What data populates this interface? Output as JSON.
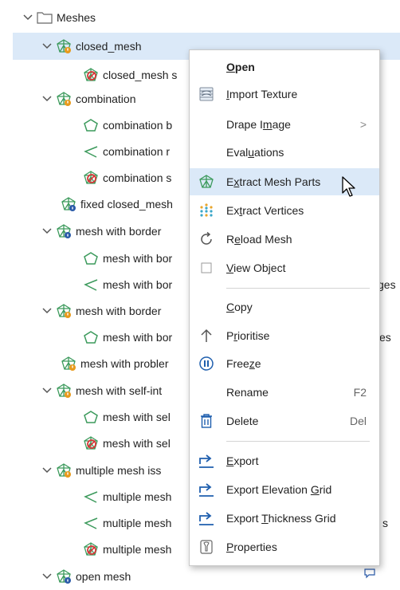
{
  "tree": {
    "rows": [
      {
        "label": "Meshes",
        "icon": "folder-icon",
        "expanded": true,
        "trail": ""
      },
      {
        "label": "closed_mesh",
        "icon": "mesh-warning-icon",
        "expanded": true,
        "trail": ""
      },
      {
        "label": "closed_mesh s",
        "icon": "mesh-error-icon",
        "expanded": null,
        "trail": ""
      },
      {
        "label": "combination",
        "icon": "mesh-warning-icon",
        "expanded": true,
        "trail": ""
      },
      {
        "label": "combination b",
        "icon": "boundary-icon",
        "expanded": null,
        "trail": ""
      },
      {
        "label": "combination r",
        "icon": "open-edges-icon",
        "expanded": null,
        "trail": ""
      },
      {
        "label": "combination s",
        "icon": "mesh-error-icon",
        "expanded": null,
        "trail": ""
      },
      {
        "label": "fixed closed_mesh",
        "icon": "mesh-info-icon",
        "expanded": null,
        "trail": ""
      },
      {
        "label": "mesh with border",
        "icon": "mesh-info-icon",
        "expanded": true,
        "trail": ""
      },
      {
        "label": "mesh with bor",
        "icon": "boundary-icon",
        "expanded": null,
        "trail": ""
      },
      {
        "label": "mesh with bor",
        "icon": "open-edges-icon",
        "expanded": null,
        "trail": "ges"
      },
      {
        "label": "mesh with border",
        "icon": "mesh-warning-icon",
        "expanded": true,
        "trail": ""
      },
      {
        "label": "mesh with bor",
        "icon": "boundary-icon",
        "expanded": null,
        "trail": "es"
      },
      {
        "label": "mesh with probler",
        "icon": "mesh-warning-icon",
        "expanded": null,
        "trail": ""
      },
      {
        "label": "mesh with self-int",
        "icon": "mesh-warning-icon",
        "expanded": true,
        "trail": ""
      },
      {
        "label": "mesh with sel",
        "icon": "boundary-icon",
        "expanded": null,
        "trail": ""
      },
      {
        "label": "mesh with sel",
        "icon": "mesh-error-icon",
        "expanded": null,
        "trail": ""
      },
      {
        "label": "multiple mesh iss",
        "icon": "mesh-warning-icon",
        "expanded": true,
        "trail": ""
      },
      {
        "label": "multiple mesh",
        "icon": "open-edges-icon",
        "expanded": null,
        "trail": ""
      },
      {
        "label": "multiple mesh",
        "icon": "open-edges-icon",
        "expanded": null,
        "trail": "s"
      },
      {
        "label": "multiple mesh",
        "icon": "mesh-error-icon",
        "expanded": null,
        "trail": ""
      },
      {
        "label": "open mesh",
        "icon": "mesh-info-icon",
        "expanded": true,
        "trail": ""
      }
    ]
  },
  "menu": {
    "items": [
      {
        "label": "Open",
        "icon": "",
        "bold": true,
        "shortcut": "",
        "submenu": false
      },
      {
        "label": "Import Texture",
        "icon": "texture-icon",
        "shortcut": "",
        "submenu": false
      },
      {
        "label": "Drape Image",
        "icon": "",
        "shortcut": "",
        "submenu": true
      },
      {
        "label": "Evaluations",
        "icon": "",
        "shortcut": "",
        "submenu": false
      },
      {
        "label": "Extract Mesh Parts",
        "icon": "extract-mesh-icon",
        "shortcut": "",
        "submenu": false,
        "hover": true
      },
      {
        "label": "Extract Vertices",
        "icon": "vertices-icon",
        "shortcut": "",
        "submenu": false
      },
      {
        "label": "Reload Mesh",
        "icon": "reload-icon",
        "shortcut": "",
        "submenu": false
      },
      {
        "label": "View Object",
        "icon": "checkbox-icon",
        "shortcut": "",
        "submenu": false
      },
      {
        "label": "Copy",
        "icon": "",
        "shortcut": "",
        "submenu": false
      },
      {
        "label": "Prioritise",
        "icon": "arrow-up-icon",
        "shortcut": "",
        "submenu": false
      },
      {
        "label": "Freeze",
        "icon": "pause-icon",
        "shortcut": "",
        "submenu": false
      },
      {
        "label": "Rename",
        "icon": "",
        "shortcut": "F2",
        "submenu": false
      },
      {
        "label": "Delete",
        "icon": "trash-icon",
        "shortcut": "Del",
        "submenu": false
      },
      {
        "label": "Export",
        "icon": "export-icon",
        "shortcut": "",
        "submenu": false
      },
      {
        "label": "Export Elevation Grid",
        "icon": "export-icon",
        "shortcut": "",
        "submenu": false
      },
      {
        "label": "Export Thickness Grid",
        "icon": "export-icon",
        "shortcut": "",
        "submenu": false
      },
      {
        "label": "Properties",
        "icon": "properties-icon",
        "shortcut": "",
        "submenu": false
      }
    ],
    "submenu_glyph": ">"
  },
  "colors": {
    "selection": "#dbe9f8",
    "mesh_green": "#3c9a5c",
    "warning_orange": "#e89a1b",
    "error_red": "#d9383a",
    "info_blue": "#2a5aa8",
    "accent_blue": "#1f5fae"
  }
}
